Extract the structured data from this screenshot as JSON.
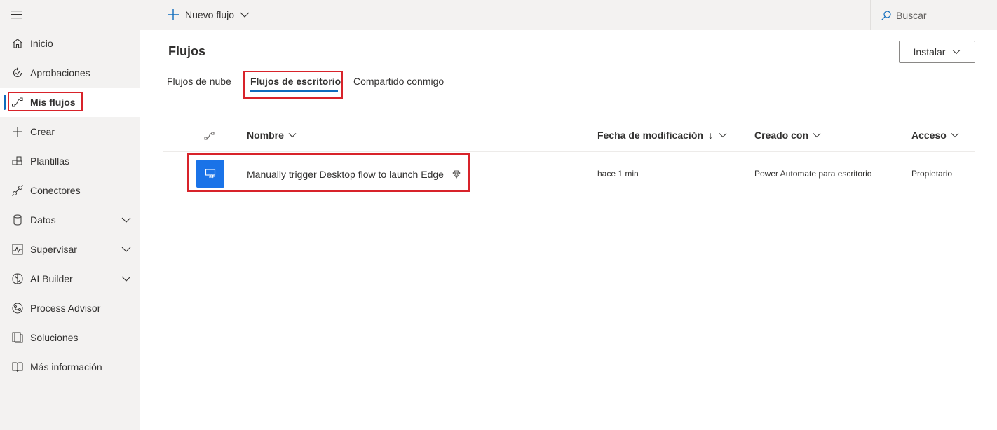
{
  "sidebar": {
    "items": [
      {
        "label": "Inicio",
        "icon": "home-icon"
      },
      {
        "label": "Aprobaciones",
        "icon": "approvals-icon"
      },
      {
        "label": "Mis flujos",
        "icon": "flows-icon",
        "selected": true
      },
      {
        "label": "Crear",
        "icon": "plus-icon"
      },
      {
        "label": "Plantillas",
        "icon": "templates-icon"
      },
      {
        "label": "Conectores",
        "icon": "connectors-icon"
      },
      {
        "label": "Datos",
        "icon": "data-icon",
        "expandable": true
      },
      {
        "label": "Supervisar",
        "icon": "monitor-icon",
        "expandable": true
      },
      {
        "label": "AI Builder",
        "icon": "ai-builder-icon",
        "expandable": true
      },
      {
        "label": "Process Advisor",
        "icon": "process-advisor-icon"
      },
      {
        "label": "Soluciones",
        "icon": "solutions-icon"
      },
      {
        "label": "Más información",
        "icon": "book-icon"
      }
    ]
  },
  "topbar": {
    "new_flow_label": "Nuevo flujo",
    "search_label": "Buscar"
  },
  "main": {
    "title": "Flujos",
    "install_label": "Instalar",
    "tabs": [
      {
        "label": "Flujos de nube"
      },
      {
        "label": "Flujos de escritorio",
        "active": true
      },
      {
        "label": "Compartido conmigo"
      }
    ],
    "table": {
      "columns": [
        "Nombre",
        "Fecha de modificación",
        "Creado con",
        "Acceso"
      ],
      "sort_indicator": "↓",
      "rows": [
        {
          "name": "Manually trigger Desktop flow to launch Edge",
          "modified": "hace 1 min",
          "created_with": "Power Automate para escritorio",
          "access": "Propietario"
        }
      ]
    }
  },
  "colors": {
    "accent": "#0f6cbd",
    "flow_icon_bg": "#1a73e8",
    "highlight": "#d8232a",
    "sidebar_bg": "#f3f2f1"
  }
}
